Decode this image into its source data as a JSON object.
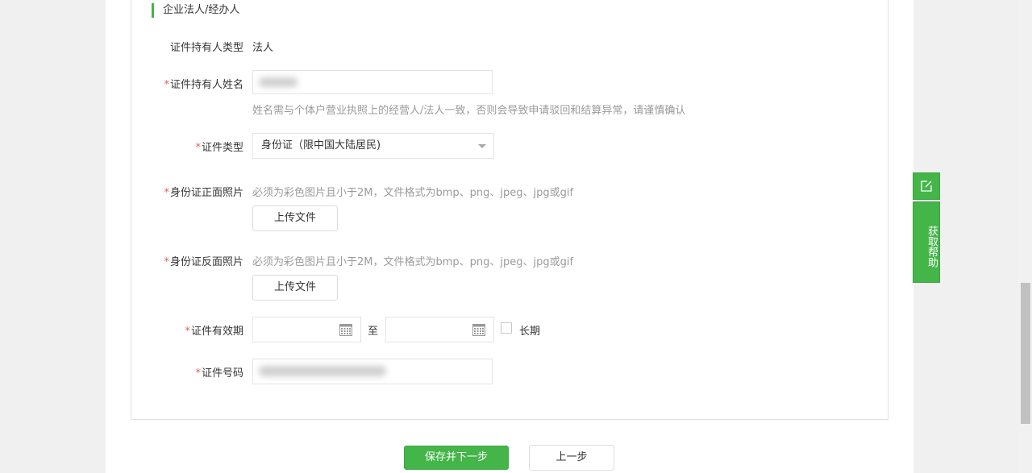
{
  "section": {
    "title": "企业法人/经办人"
  },
  "form": {
    "holder_type": {
      "label": "证件持有人类型",
      "value": "法人"
    },
    "holder_name": {
      "label": "证件持有人姓名",
      "required_mark": "*",
      "value": "",
      "tip": "姓名需与个体户营业执照上的经营人/法人一致，否则会导致申请驳回和结算异常，请谨慎确认"
    },
    "id_type": {
      "label": "证件类型",
      "required_mark": "*",
      "selected": "身份证（限中国大陆居民)"
    },
    "id_front": {
      "label": "身份证正面照片",
      "required_mark": "*",
      "tip": "必须为彩色图片且小于2M，文件格式为bmp、png、jpeg、jpg或gif",
      "button": "上传文件"
    },
    "id_back": {
      "label": "身份证反面照片",
      "required_mark": "*",
      "tip": "必须为彩色图片且小于2M，文件格式为bmp、png、jpeg、jpg或gif",
      "button": "上传文件"
    },
    "validity": {
      "label": "证件有效期",
      "required_mark": "*",
      "to": "至",
      "long_term": "长期",
      "long_term_checked": false
    },
    "id_number": {
      "label": "证件号码",
      "required_mark": "*",
      "value": ""
    }
  },
  "actions": {
    "save_next": "保存并下一步",
    "prev": "上一步"
  },
  "help": {
    "label": "获取帮助",
    "chars": [
      "获",
      "取",
      "帮",
      "助"
    ]
  },
  "colors": {
    "accent": "#44b549",
    "required": "#e15f63",
    "tip": "#9a9a9a"
  },
  "icons": [
    "calendar-icon",
    "edit-icon",
    "chevron-down-icon"
  ]
}
